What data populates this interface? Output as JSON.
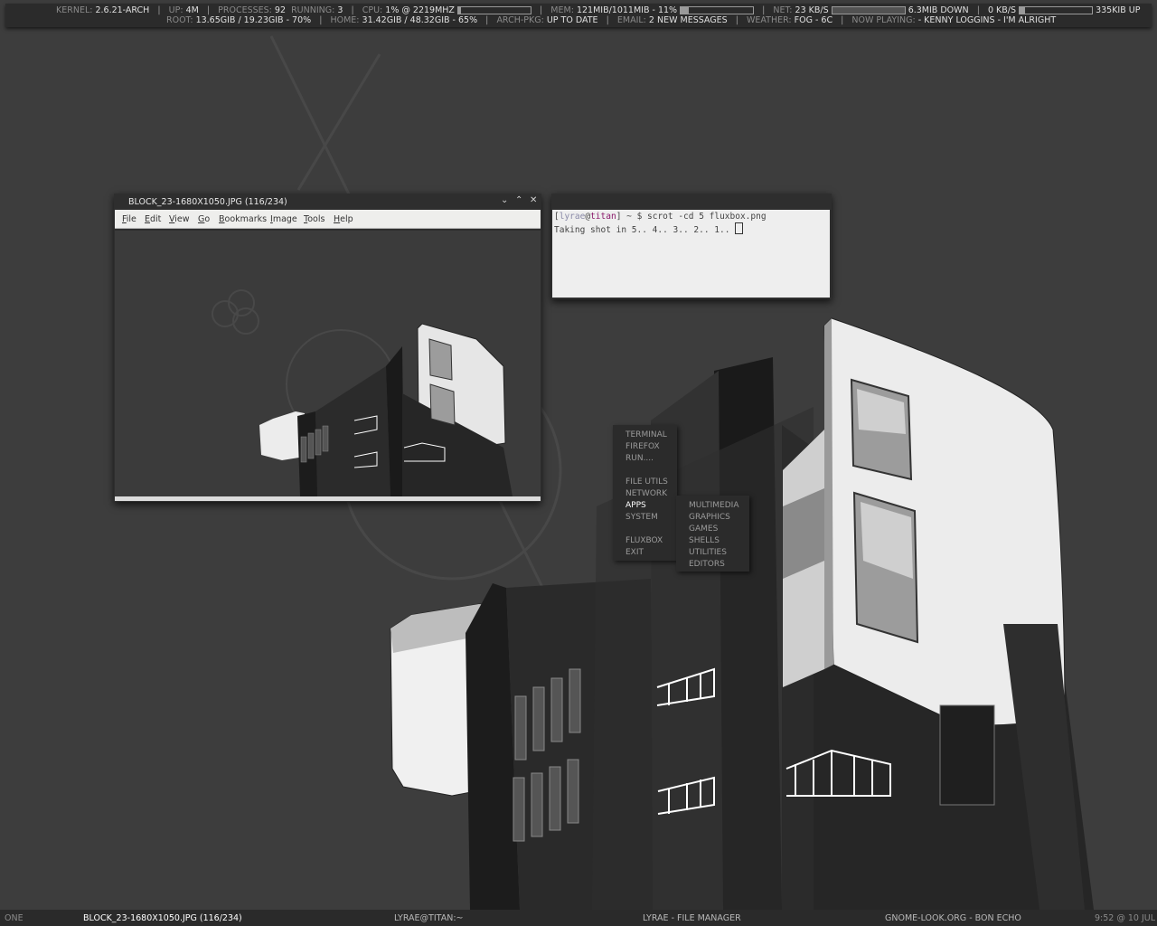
{
  "conky": {
    "row1": {
      "kernel_label": "KERNEL:",
      "kernel": "2.6.21-ARCH",
      "up_label": "UP:",
      "up": "4M",
      "processes_label": "PROCESSES:",
      "processes": "92",
      "running_label": "RUNNING:",
      "running": "3",
      "cpu_label": "CPU:",
      "cpu": "1%",
      "cpu_freq": "@ 2219MHZ",
      "mem_label": "MEM:",
      "mem": "121MIB/1011MIB - 11%",
      "mem_fraction": 0.11,
      "net_label": "NET:",
      "net_down_speed": "23 KB/S",
      "net_down_total": "6.3MIB DOWN",
      "net_up_speed": "0 KB/S",
      "net_up_total": "335KIB UP"
    },
    "row2": {
      "root_label": "ROOT:",
      "root": "13.65GIB / 19.23GIB - 70%",
      "home_label": "HOME:",
      "home": "31.42GIB / 48.32GIB - 65%",
      "archpkg_label": "ARCH-PKG:",
      "archpkg": "UP TO DATE",
      "email_label": "EMAIL:",
      "email": "2 NEW MESSAGES",
      "weather_label": "WEATHER:",
      "weather": "FOG - 6C",
      "nowplaying_label": "NOW PLAYING:",
      "nowplaying": "- KENNY LOGGINS - I'M ALRIGHT"
    },
    "sep": "|"
  },
  "viewer": {
    "title": "BLOCK_23-1680X1050.JPG  (116/234)",
    "menu": [
      {
        "label": "File",
        "u": "F",
        "rest": "ile"
      },
      {
        "label": "Edit",
        "u": "E",
        "rest": "dit"
      },
      {
        "label": "View",
        "u": "V",
        "rest": "iew"
      },
      {
        "label": "Go",
        "u": "G",
        "rest": "o"
      },
      {
        "label": "Bookmarks",
        "u": "B",
        "rest": "ookmarks"
      },
      {
        "label": "Image",
        "u": "I",
        "rest": "mage"
      },
      {
        "label": "Tools",
        "u": "T",
        "rest": "ools"
      },
      {
        "label": "Help",
        "u": "H",
        "rest": "elp"
      }
    ],
    "buttons": {
      "minimize": "⌄",
      "maximize": "⌃",
      "close": "✕"
    }
  },
  "terminal": {
    "prompt_open": "[",
    "user": "lyrae",
    "at": "@",
    "host": "titan",
    "prompt_close": "] ~ $ ",
    "command": "scrot -cd 5 fluxbox.png",
    "output": "Taking shot in 5.. 4.. 3.. 2.. 1.. ",
    "colors": {
      "user": "#8a8aa8",
      "host": "#8b1a6b"
    }
  },
  "root_menu": {
    "items": [
      "TERMINAL",
      "FIREFOX",
      "RUN....",
      "",
      "FILE UTILS",
      "NETWORK",
      "APPS",
      "SYSTEM",
      "",
      "FLUXBOX",
      "EXIT"
    ],
    "selected": "APPS"
  },
  "apps_submenu": {
    "items": [
      "MULTIMEDIA",
      "GRAPHICS",
      "GAMES",
      "SHELLS",
      "UTILITIES",
      "EDITORS"
    ]
  },
  "taskbar": {
    "workspace": "ONE",
    "tasks": [
      "BLOCK_23-1680X1050.JPG  (116/234)",
      "LYRAE@TITAN:~",
      "LYRAE - FILE MANAGER",
      "GNOME-LOOK.ORG - BON ECHO"
    ],
    "clock": "9:52 @ 10 JUL"
  },
  "colors": {
    "background": "#3d3d3d",
    "panel": "#2b2b2b",
    "text": "#e0e0e0",
    "dim": "#8a8a8a"
  }
}
